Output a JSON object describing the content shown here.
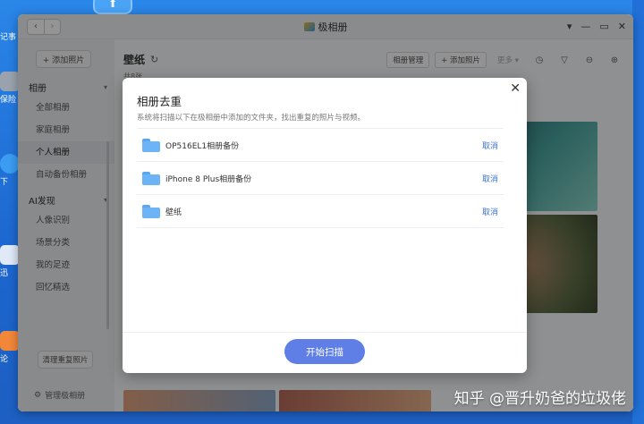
{
  "desktop": {
    "labels": [
      "记事",
      "保险",
      "下",
      "迅",
      "论"
    ]
  },
  "window": {
    "title": "极相册",
    "controls": [
      "▾",
      "—",
      "▭",
      "✕"
    ]
  },
  "sidebar": {
    "add_photo": "+ 添加照片",
    "album_section": "相册",
    "album_items": [
      "全部相册",
      "家庭相册",
      "个人相册",
      "自动备份相册"
    ],
    "ai_section": "AI发现",
    "ai_items": [
      "人像识别",
      "场景分类",
      "我的足迹",
      "回忆精选"
    ],
    "clean_button": "清理重复照片",
    "manage_link": "管理极相册"
  },
  "main": {
    "title": "壁纸",
    "count_text": "共8张",
    "toolbar": {
      "manage": "相册管理",
      "add": "+ 添加照片",
      "more": "更多 ▾"
    }
  },
  "modal": {
    "title": "相册去重",
    "description": "系统将扫描以下在极相册中添加的文件夹，找出重复的照片与视频。",
    "folders": [
      {
        "name": "OP516EL1相册备份",
        "action": "取消"
      },
      {
        "name": "iPhone 8 Plus相册备份",
        "action": "取消"
      },
      {
        "name": "壁纸",
        "action": "取消"
      }
    ],
    "start_button": "开始扫描",
    "close": "✕"
  },
  "watermark": "知乎 @晋升奶爸的垃圾佬",
  "colors": {
    "accent": "#5f7fe6",
    "link": "#3f73d8",
    "desktop": "#1f6fd6"
  }
}
